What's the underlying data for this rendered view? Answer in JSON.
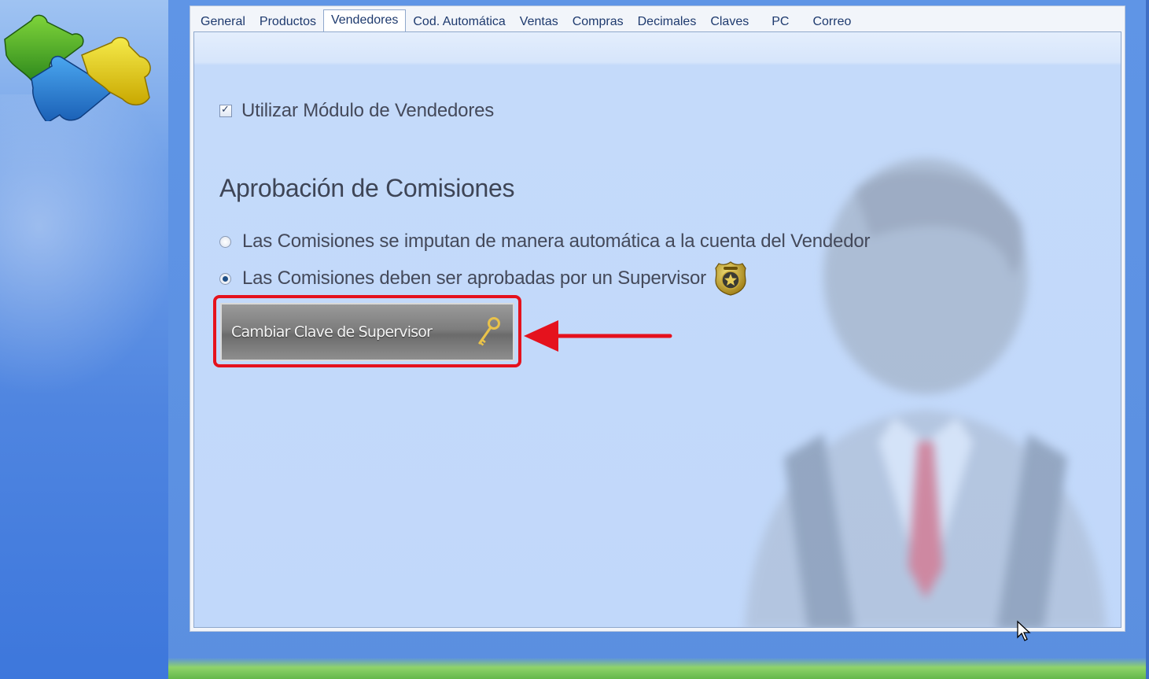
{
  "tabs": [
    {
      "label": "General",
      "active": false
    },
    {
      "label": "Productos",
      "active": false
    },
    {
      "label": "Vendedores",
      "active": true
    },
    {
      "label": "Cod. Automática",
      "active": false
    },
    {
      "label": "Ventas",
      "active": false
    },
    {
      "label": "Compras",
      "active": false
    },
    {
      "label": "Decimales",
      "active": false
    },
    {
      "label": "Claves",
      "active": false
    },
    {
      "label": "PC",
      "active": false
    },
    {
      "label": "Correo",
      "active": false
    }
  ],
  "vendedores": {
    "use_module": {
      "label": "Utilizar Módulo de Vendedores",
      "checked": true
    },
    "section_title": "Aprobación de Comisiones",
    "options": [
      {
        "label": "Las Comisiones se imputan de manera automática a la cuenta del Vendedor",
        "selected": false
      },
      {
        "label": "Las Comisiones deben ser aprobadas por un Supervisor",
        "selected": true,
        "icon": "security-badge-icon"
      }
    ],
    "change_password_button": {
      "label": "Cambiar Clave de Supervisor",
      "icon": "key-icon"
    }
  },
  "annotation": {
    "highlight_color": "#e5121d",
    "arrow_color": "#e5121d"
  }
}
